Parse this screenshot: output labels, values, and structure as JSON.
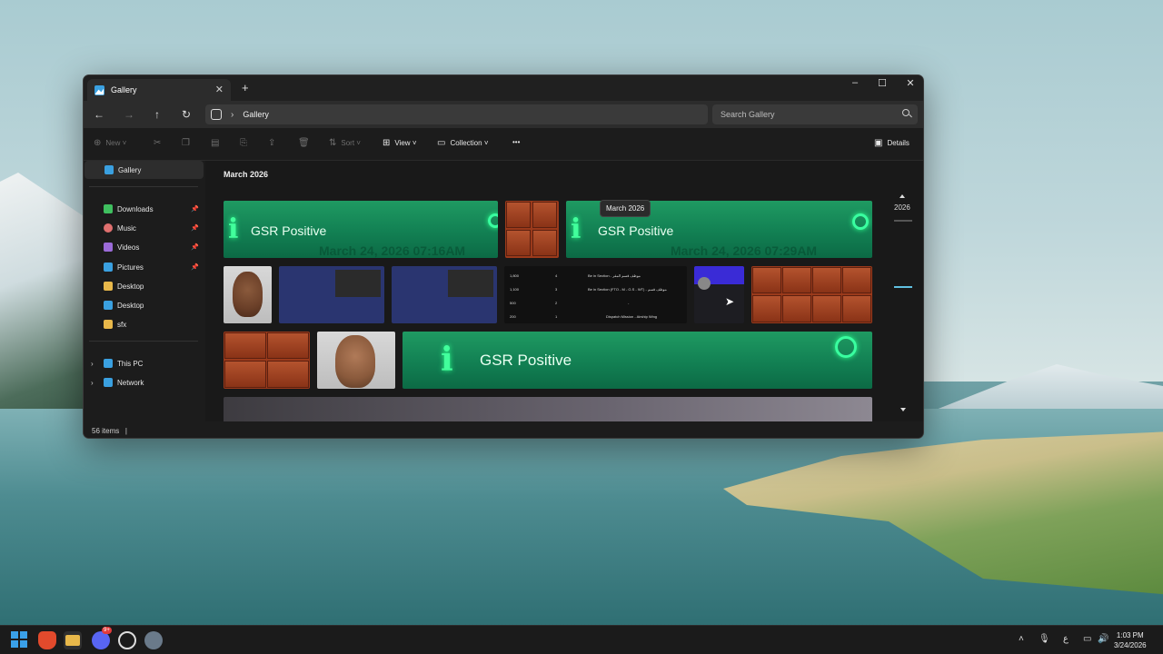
{
  "window": {
    "tab_title": "Gallery",
    "new_tab": "+",
    "controls": {
      "minimize": "–",
      "maximize": "☐",
      "close": "✕"
    }
  },
  "address": {
    "path": "Gallery",
    "search_placeholder": "Search Gallery"
  },
  "toolbar": {
    "new": "New",
    "sort": "Sort",
    "view": "View",
    "collection": "Collection",
    "more": "•••",
    "details": "Details"
  },
  "sidebar": {
    "gallery": "Gallery",
    "items": [
      {
        "label": "Downloads",
        "color": "#3fbf5f"
      },
      {
        "label": "Music",
        "color": "#e0706f"
      },
      {
        "label": "Videos",
        "color": "#9b6bd8"
      },
      {
        "label": "Pictures",
        "color": "#3aa0e0"
      },
      {
        "label": "Desktop",
        "color": "#e8b84a"
      },
      {
        "label": "Desktop",
        "color": "#3aa0e0"
      },
      {
        "label": "sfx",
        "color": "#e8b84a"
      }
    ],
    "this_pc": "This PC",
    "network": "Network"
  },
  "content": {
    "month_heading": "March 2026",
    "tooltip": "March 2026",
    "year_marker": "2026",
    "gsr_label": "GSR Positive",
    "gsr_timestamp_1": "March 24, 2026 07:16AM",
    "gsr_timestamp_2": "March 24, 2026 07:29AM",
    "table_rows": [
      {
        "a": "1,800",
        "b": "4",
        "c": "Be in Section - ﻣﻮﻇﻒ ﻗﺴﻢ ﺍﻟﻤﻘﺮ"
      },
      {
        "a": "1,100",
        "b": "3",
        "c": "Be in Section (FTO - M - G.S - WT) - ﻣﻮﻇﻒ ﻗﺴﻢ"
      },
      {
        "a": "500",
        "b": "2",
        "c": "-"
      },
      {
        "a": "200",
        "b": "1",
        "c": "Dispatch Mission - Airship Wing"
      }
    ]
  },
  "status": {
    "count": "56 items",
    "divider": "|"
  },
  "taskbar": {
    "time": "1:03 PM",
    "date": "3/24/2026",
    "lang": "ع",
    "badge": "9+"
  }
}
